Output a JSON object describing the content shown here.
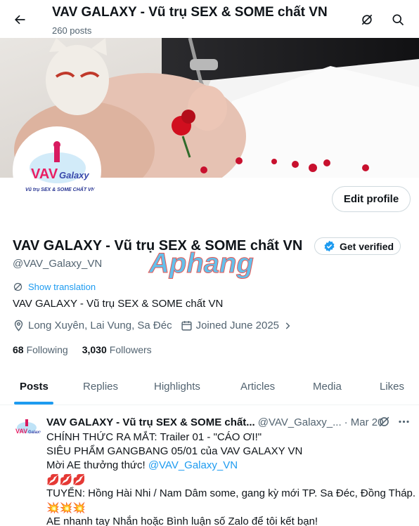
{
  "header": {
    "title": "VAV GALAXY - Vũ trụ SEX & SOME chất VN",
    "post_count": "260 posts",
    "back_icon": "arrow-left-icon",
    "icons": [
      "lens-off-icon",
      "search-icon"
    ]
  },
  "profile": {
    "avatar_logo_text": "VAV Galaxy",
    "avatar_logo_sub": "Vũ trụ SEX & SOME CHẤT VN",
    "edit_label": "Edit profile",
    "name": "VAV GALAXY - Vũ trụ SEX & SOME chất VN",
    "verified_label": "Get verified",
    "handle": "@VAV_Galaxy_VN",
    "translate_label": "Show translation",
    "bio": "VAV GALAXY - Vũ trụ SEX & SOME chất VN",
    "location": "Long Xuyên, Lai Vung, Sa Đéc",
    "joined": "Joined June 2025",
    "following_count": "68",
    "following_label": "Following",
    "followers_count": "3,030",
    "followers_label": "Followers"
  },
  "watermark": "Aphang",
  "tabs": [
    "Posts",
    "Replies",
    "Highlights",
    "Articles",
    "Media",
    "Likes"
  ],
  "active_tab": "Posts",
  "post": {
    "name": "VAV GALAXY - Vũ trụ SEX & SOME chất...",
    "handle": "@VAV_Galaxy_...",
    "date": "· Mar 20",
    "line1": "CHÍNH THỨC RA MẮT: Trailer 01 - \"CÁO ƠI!\"",
    "line2": "SIÊU PHẨM GANGBANG 05/01 của VAV GALAXY VN",
    "line3_prefix": "Mời AE thưởng thức! ",
    "line3_link": "@VAV_Galaxy_VN",
    "line4_emoji": "💋💋💋",
    "line5": "TUYỂN: Hồng Hài Nhi / Nam Dâm some, gang kỳ mới TP. Sa Đéc, Đồng Tháp.",
    "line6_emoji": "💥💥💥",
    "line7": "AE nhanh tay Nhắn hoặc Bình luận số Zalo để tôi kết bạn!"
  },
  "colors": {
    "accent": "#1d9bf0",
    "text": "#0f1419",
    "muted": "#536471"
  }
}
